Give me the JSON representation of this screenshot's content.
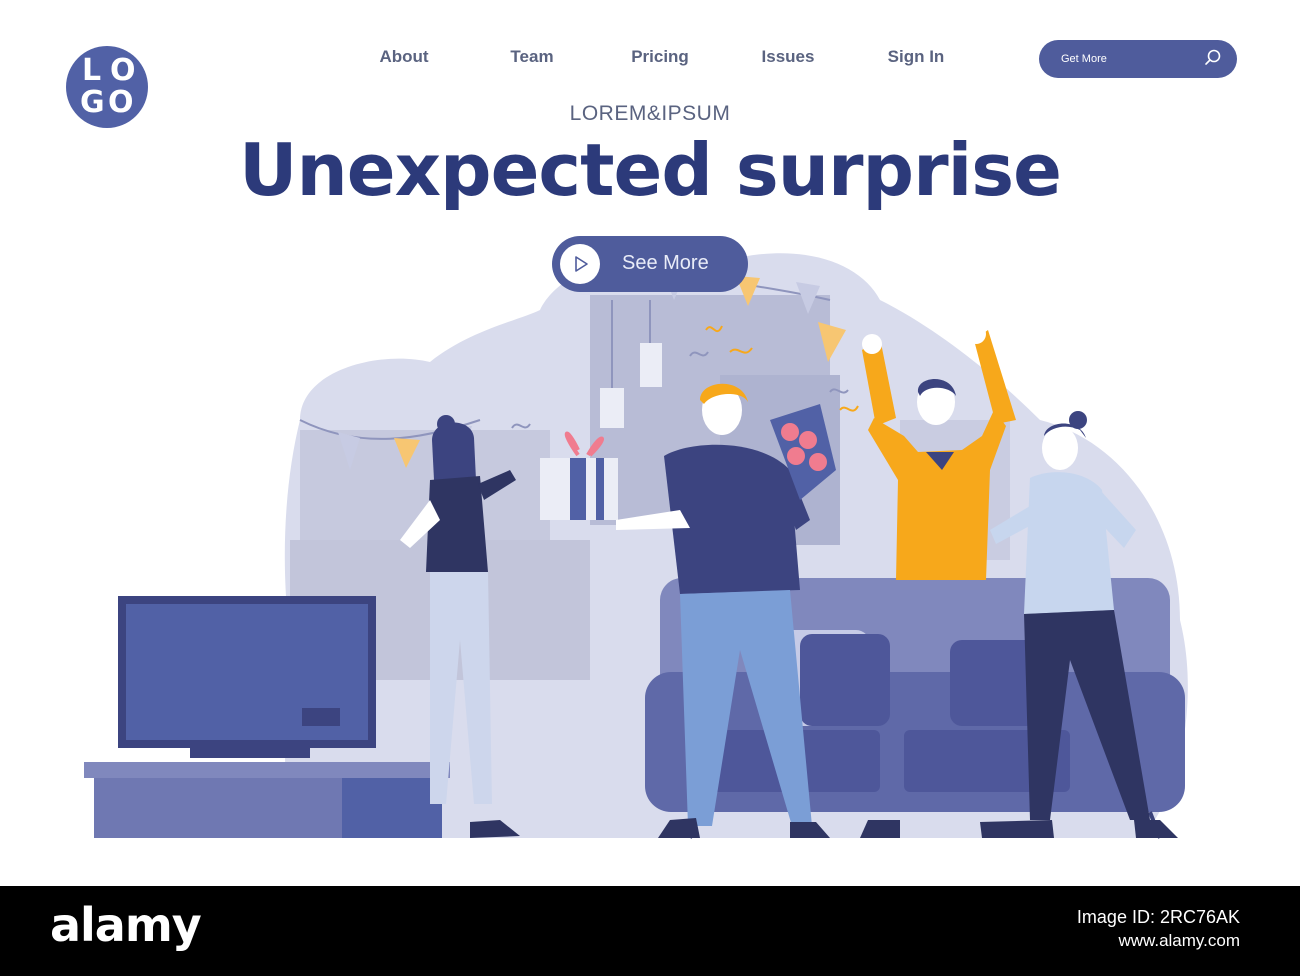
{
  "logo": {
    "letters": [
      "L",
      "O",
      "G",
      "O"
    ]
  },
  "nav": {
    "items": [
      {
        "label": "About"
      },
      {
        "label": "Team"
      },
      {
        "label": "Pricing"
      },
      {
        "label": "Issues"
      },
      {
        "label": "Sign In"
      }
    ]
  },
  "search": {
    "placeholder": "Get More",
    "icon": "search-icon"
  },
  "hero": {
    "subtitle": "LOREM&IPSUM",
    "title": "Unexpected surprise",
    "cta_label": "See More",
    "cta_icon": "play-icon"
  },
  "watermark": {
    "brand": "alamy",
    "image_id": "Image ID: 2RC76AK",
    "url": "www.alamy.com",
    "overlay_text": "alamy"
  },
  "colors": {
    "primary": "#2c3a7a",
    "accent": "#4f5c9c",
    "nav_text": "#5a6380",
    "yellow": "#f7a81b",
    "pink": "#f07c8f"
  }
}
